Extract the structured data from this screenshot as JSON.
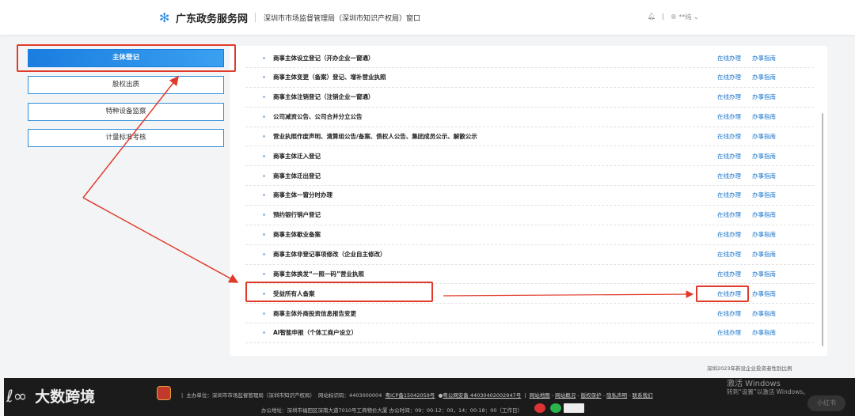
{
  "header": {
    "site_name": "广东政务服务网",
    "department": "深圳市市场监督管理局（深圳市知识产权局）窗口",
    "user": "**纯"
  },
  "sidebar": {
    "items": [
      {
        "label": "主体登记",
        "active": true
      },
      {
        "label": "股权出质"
      },
      {
        "label": "特种设备监察"
      },
      {
        "label": "计量标准考核"
      }
    ]
  },
  "services": {
    "online_label": "在线办理",
    "guide_label": "办事指南",
    "items": [
      "商事主体设立登记（开办企业一窗通）",
      "商事主体变更（备案）登记、增补营业执照",
      "商事主体注销登记（注销企业一窗通）",
      "公司减资公告、公司合并分立公告",
      "营业执照作废声明、清算组公告/备案、债权人公告、集团成员公示、解散公示",
      "商事主体迁入登记",
      "商事主体迁出登记",
      "商事主体一窗分时办理",
      "预约银行销户登记",
      "商事主体歇业备案",
      "商事主体非登记事项修改（企业自主修改）",
      "商事主体换发“一照一码”营业执照",
      "受益所有人备案",
      "商事主体外商投资信息报告变更",
      "AI智能申报（个体工商户设立）"
    ]
  },
  "caption": "深圳2023年新设企业投资者性别比例",
  "footer": {
    "brand": "大数跨境",
    "sponsor": "主办单位：深圳市市场监督管理局（深圳市知识产权局）",
    "site_id": "网站标识码：4403000004",
    "icp": "粤ICP备15042059号",
    "police": "粤公网安备 44030402002947号",
    "links": [
      "网站地图",
      "网站概况",
      "版权保护",
      "隐私声明",
      "联系我们"
    ],
    "address": "办公地址：深圳市福田区深南大道7010号工商物价大厦 办公时间：09：00-12：00，14：00-18：00（工作日）"
  },
  "overlay": {
    "activate_title": "激活 Windows",
    "activate_sub": "转到“设置”以激活 Windows。",
    "watermark": "小红书"
  },
  "colors": {
    "accent": "#1a7de0",
    "annotation": "#e03a2a",
    "link": "#1a73c8"
  }
}
